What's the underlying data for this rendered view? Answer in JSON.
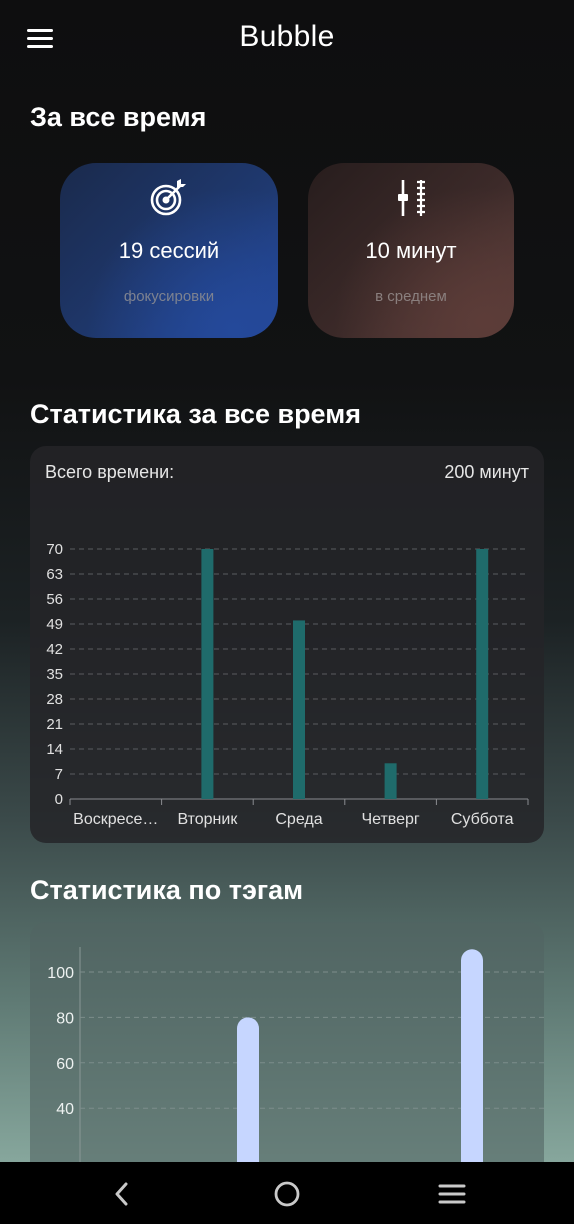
{
  "app": {
    "title": "Bubble"
  },
  "all_time": {
    "heading": "За все время",
    "sessions_card": {
      "icon": "target-icon",
      "value": "19 сессий",
      "caption": "фокусировки"
    },
    "average_card": {
      "icon": "sliders-icon",
      "value": "10 минут",
      "caption": "в среднем"
    }
  },
  "weekly_stats": {
    "heading": "Статистика за все время",
    "total_label": "Всего времени:",
    "total_value": "200 минут"
  },
  "tag_stats": {
    "heading": "Статистика по тэгам"
  },
  "chart_data": [
    {
      "type": "bar",
      "categories": [
        "Воскресе…",
        "Вторник",
        "Среда",
        "Четверг",
        "Суббота"
      ],
      "values": [
        0,
        70,
        50,
        10,
        70
      ],
      "ylim": [
        0,
        70
      ],
      "yticks": [
        0,
        7,
        14,
        21,
        28,
        35,
        42,
        49,
        56,
        63,
        70
      ],
      "grid": true,
      "color": "#1f6b6b"
    },
    {
      "type": "bar",
      "categories": [
        "",
        ""
      ],
      "values": [
        80,
        110
      ],
      "yticks": [
        40,
        60,
        80,
        100
      ],
      "grid": true,
      "color": "#c6d6ff"
    }
  ],
  "system_nav": {
    "back": "back-icon",
    "home": "home-icon",
    "recents": "recents-icon"
  }
}
